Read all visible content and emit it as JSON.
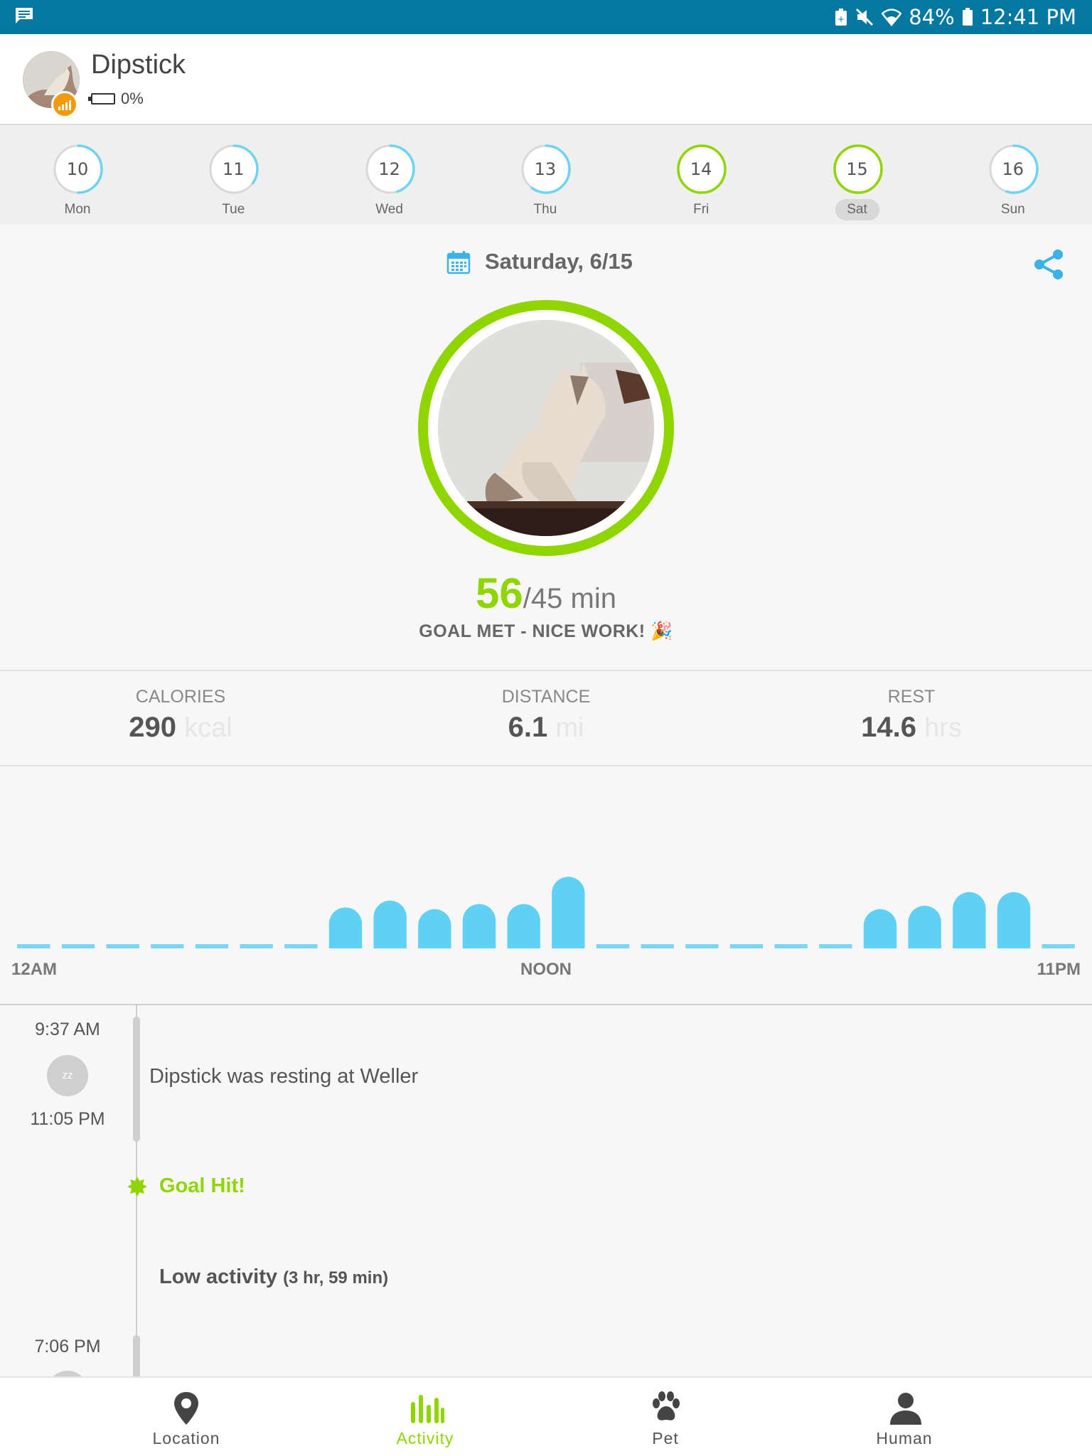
{
  "status_bar": {
    "battery": "84%",
    "time": "12:41 PM"
  },
  "header": {
    "pet_name": "Dipstick",
    "battery_level": "0%"
  },
  "week": [
    {
      "num": "10",
      "day": "Mon",
      "progress": 0.5,
      "goal_met": false
    },
    {
      "num": "11",
      "day": "Tue",
      "progress": 0.35,
      "goal_met": false
    },
    {
      "num": "12",
      "day": "Wed",
      "progress": 0.45,
      "goal_met": false
    },
    {
      "num": "13",
      "day": "Thu",
      "progress": 0.6,
      "goal_met": false
    },
    {
      "num": "14",
      "day": "Fri",
      "progress": 1.0,
      "goal_met": true
    },
    {
      "num": "15",
      "day": "Sat",
      "progress": 1.0,
      "goal_met": true,
      "selected": true
    },
    {
      "num": "16",
      "day": "Sun",
      "progress": 0.55,
      "goal_met": false
    }
  ],
  "date_title": "Saturday, 6/15",
  "goal": {
    "value": "56",
    "target": "/45 min",
    "message": "GOAL MET - NICE WORK! 🎉"
  },
  "stats": {
    "calories": {
      "title": "CALORIES",
      "value": "290",
      "unit": "kcal"
    },
    "distance": {
      "title": "DISTANCE",
      "value": "6.1",
      "unit": "mi"
    },
    "rest": {
      "title": "REST",
      "value": "14.6",
      "unit": "hrs"
    }
  },
  "chart_data": {
    "type": "bar",
    "title": "",
    "xlabel": "",
    "ylabel": "",
    "x_tick_labels": [
      "12AM",
      "NOON",
      "11PM"
    ],
    "categories": [
      "12AM",
      "1AM",
      "2AM",
      "3AM",
      "4AM",
      "5AM",
      "6AM",
      "7AM",
      "8AM",
      "9AM",
      "10AM",
      "11AM",
      "NOON",
      "1PM",
      "2PM",
      "3PM",
      "4PM",
      "5PM",
      "6PM",
      "7PM",
      "8PM",
      "9PM",
      "10PM",
      "11PM"
    ],
    "values": [
      0,
      0,
      0,
      0,
      0,
      0,
      0,
      2.4,
      2.8,
      2.3,
      2.6,
      2.6,
      4.2,
      0,
      0,
      0,
      0,
      0,
      0,
      2.3,
      2.5,
      3.3,
      3.3,
      0
    ],
    "color": "#5fd1f5"
  },
  "timeline": {
    "event1_start": "9:37 AM",
    "event1_end": "11:05 PM",
    "event1_icon": "zz",
    "event1_text": "Dipstick was resting at Weller",
    "goal_hit": "Goal Hit!",
    "low_activity": "Low activity",
    "low_activity_duration": "(3 hr, 59 min)",
    "event3_start": "7:06 PM"
  },
  "nav": {
    "location": "Location",
    "activity": "Activity",
    "pet": "Pet",
    "human": "Human"
  },
  "colors": {
    "accent_green": "#8fd600",
    "accent_blue": "#5fd1f5",
    "status_bar": "#0478a0"
  }
}
